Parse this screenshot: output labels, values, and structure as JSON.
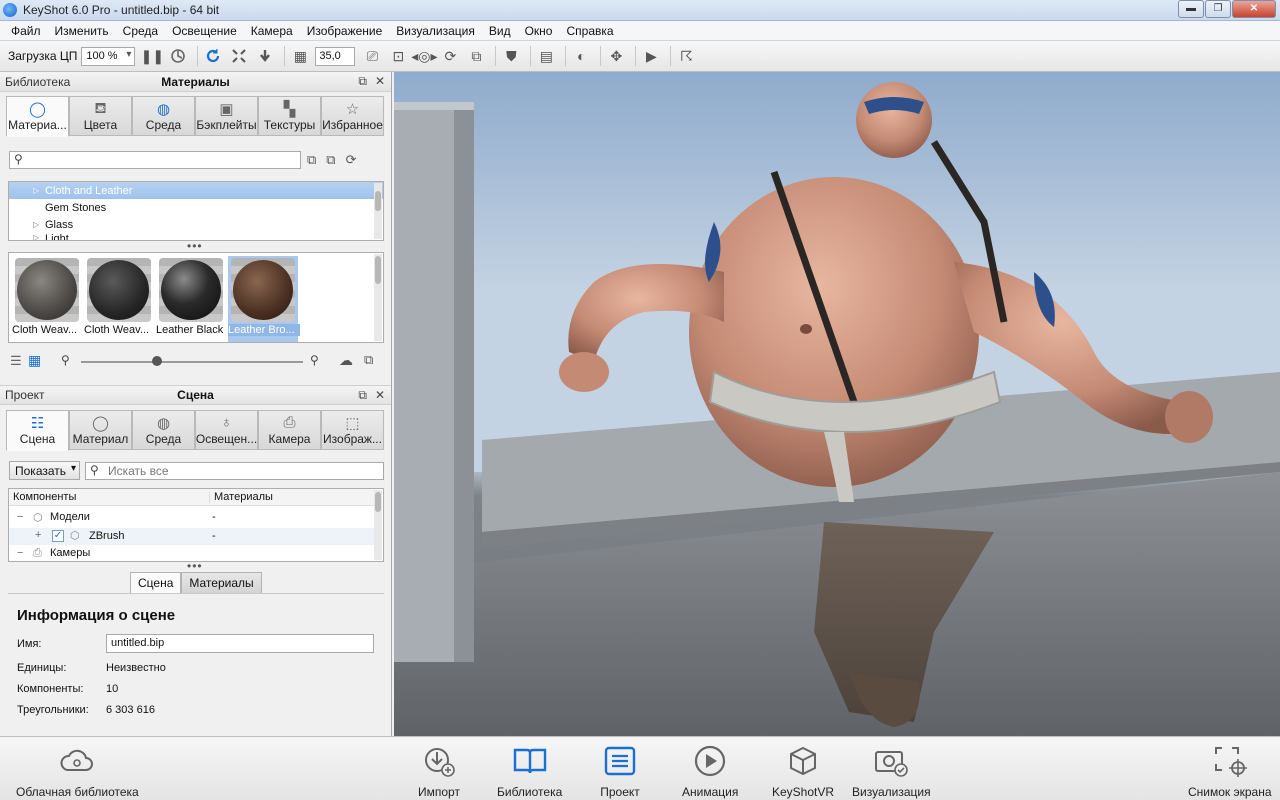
{
  "window": {
    "title": "KeyShot 6.0 Pro  - untitled.bip  - 64 bit",
    "min_label": "▬",
    "max_label": "❐",
    "close_label": "✕"
  },
  "menu": [
    "Файл",
    "Изменить",
    "Среда",
    "Освещение",
    "Камера",
    "Изображение",
    "Визуализация",
    "Вид",
    "Окно",
    "Справка"
  ],
  "toolbar": {
    "cpu_label": "Загрузка ЦП",
    "cpu_value": "100 %",
    "fov_value": "35,0"
  },
  "library": {
    "header_left": "Библиотека",
    "header_title": "Материалы",
    "tabs": [
      "Материа...",
      "Цвета",
      "Среда",
      "Бэкплейты",
      "Текстуры",
      "Избранное"
    ],
    "tree": [
      "Cloth and Leather",
      "Gem Stones",
      "Glass",
      "Light"
    ],
    "thumbnails": [
      "Cloth Weav...",
      "Cloth Weav...",
      "Leather Black",
      "Leather Bro..."
    ],
    "more": "•••"
  },
  "project": {
    "header_left": "Проект",
    "header_title": "Сцена",
    "tabs": [
      "Сцена",
      "Материал",
      "Среда",
      "Освещен...",
      "Камера",
      "Изображ..."
    ],
    "show_button": "Показать",
    "search_placeholder": "Искать все",
    "columns": [
      "Компоненты",
      "Материалы"
    ],
    "rows": [
      {
        "name": "Модели",
        "material": "-"
      },
      {
        "name": "ZBrush",
        "material": "-"
      },
      {
        "name": "Камеры",
        "material": ""
      }
    ],
    "subtabs": [
      "Сцена",
      "Материалы"
    ],
    "info_title": "Информация о сцене",
    "info": {
      "name_label": "Имя:",
      "name_value": "untitled.bip",
      "units_label": "Единицы:",
      "units_value": "Неизвестно",
      "components_label": "Компоненты:",
      "components_value": "10",
      "triangles_label": "Треугольники:",
      "triangles_value": "6 303 616"
    }
  },
  "bottombar": {
    "cloud": "Облачная библиотека",
    "import": "Импорт",
    "library": "Библиотека",
    "project": "Проект",
    "animation": "Анимация",
    "vr": "KeyShotVR",
    "render": "Визуализация",
    "screenshot": "Снимок экрана"
  },
  "colors": {
    "accent": "#1a6fd0",
    "selection": "#a6c6ec"
  }
}
